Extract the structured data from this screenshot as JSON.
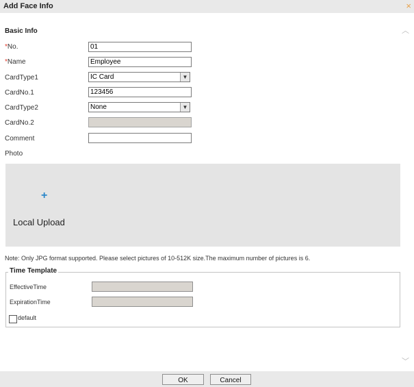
{
  "dialog": {
    "title": "Add Face Info",
    "close_glyph": "×"
  },
  "scroll": {
    "up": "︿",
    "down": "﹀"
  },
  "basic_info": {
    "section_title": "Basic Info",
    "required_marker": "*",
    "no_label": "No.",
    "no_value": "01",
    "name_label": "Name",
    "name_value": "Employee",
    "cardtype1_label": "CardType1",
    "cardtype1_value": "IC Card",
    "cardno1_label": "CardNo.1",
    "cardno1_value": "123456",
    "cardtype2_label": "CardType2",
    "cardtype2_value": "None",
    "cardno2_label": "CardNo.2",
    "comment_label": "Comment",
    "photo_label": "Photo"
  },
  "upload": {
    "plus_glyph": "+",
    "label": "Local Upload"
  },
  "note": "Note: Only JPG format supported. Please select pictures of 10-512K size.The maximum number of pictures is 6.",
  "time_template": {
    "legend": "Time Template",
    "effective_label": "EffectiveTime",
    "expiration_label": "ExpirationTime",
    "default_label": "default",
    "default_checked": false
  },
  "buttons": {
    "ok": "OK",
    "cancel": "Cancel"
  },
  "icons": {
    "close": "close-icon",
    "dropdown": "chevron-down-icon",
    "plus": "plus-icon"
  },
  "colors": {
    "required": "#e23a2b",
    "plus": "#2b87c9",
    "close": "#e8a14a"
  }
}
